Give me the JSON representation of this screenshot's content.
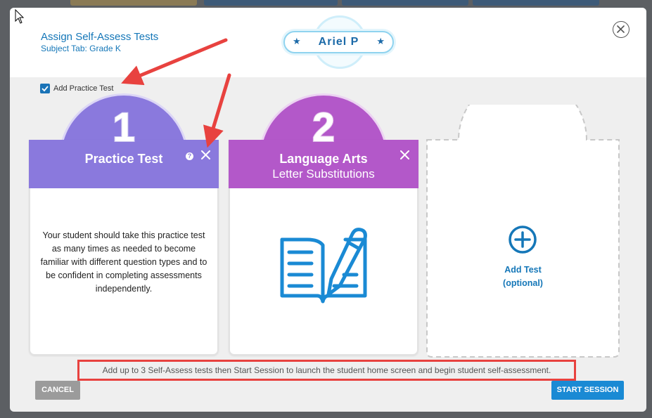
{
  "modal": {
    "title": "Assign Self-Assess Tests",
    "subtitle": "Subject Tab: Grade K",
    "close_icon": "close-circle-icon"
  },
  "student_badge": {
    "name": "Ariel P",
    "star": "★"
  },
  "practice_toggle": {
    "label": "Add Practice Test",
    "checked": true
  },
  "cards": [
    {
      "number": "1",
      "title": "Practice Test",
      "subtitle": "",
      "color": "#8a79dd",
      "help_glyph": "?",
      "description": "Your student should take this practice test as many times as needed to become familiar with different question types and to be confident in completing assessments independently."
    },
    {
      "number": "2",
      "title": "Language Arts",
      "subtitle": "Letter Substitutions",
      "color": "#b358c9",
      "icon": "book-pencil-icon"
    }
  ],
  "add_slot": {
    "line1": "Add Test",
    "line2": "(optional)",
    "icon": "plus-circle-icon"
  },
  "hint": "Add up to 3 Self-Assess tests then Start Session to launch the student home screen and begin student self-assessment.",
  "buttons": {
    "cancel": "CANCEL",
    "start": "START SESSION"
  },
  "colors": {
    "accent_blue": "#1577b8",
    "start_button": "#1a8ad4",
    "annotation_red": "#e8423f"
  }
}
